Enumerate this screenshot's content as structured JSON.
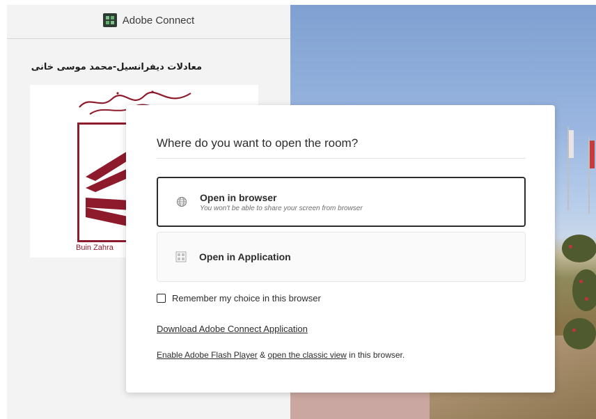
{
  "app": {
    "name": "Adobe Connect"
  },
  "room": {
    "title": "معادلات دیفرانسیل-محمد موسی خانی",
    "logo_calligraphy": "آموزش عالی زینب کبری بوئین زهرا",
    "logo_caption": "Buin Zahra"
  },
  "dialog": {
    "title": "Where do you want to open the room?",
    "options": [
      {
        "title": "Open in browser",
        "subtitle": "You won't be able to share your screen from browser",
        "icon": "globe-icon",
        "selected": true
      },
      {
        "title": "Open in Application",
        "subtitle": "",
        "icon": "app-icon",
        "selected": false
      }
    ],
    "remember_label": "Remember my choice in this browser",
    "remember_checked": false,
    "download_link": "Download Adobe Connect Application",
    "flash_link": "Enable Adobe Flash Player",
    "amp": " & ",
    "classic_link": "open the classic view",
    "classic_suffix": " in this browser."
  },
  "colors": {
    "brand_maroon": "#8e1b2c",
    "logo_dark_green": "#2e3b33",
    "dialog_border": "#2c2c2c"
  }
}
